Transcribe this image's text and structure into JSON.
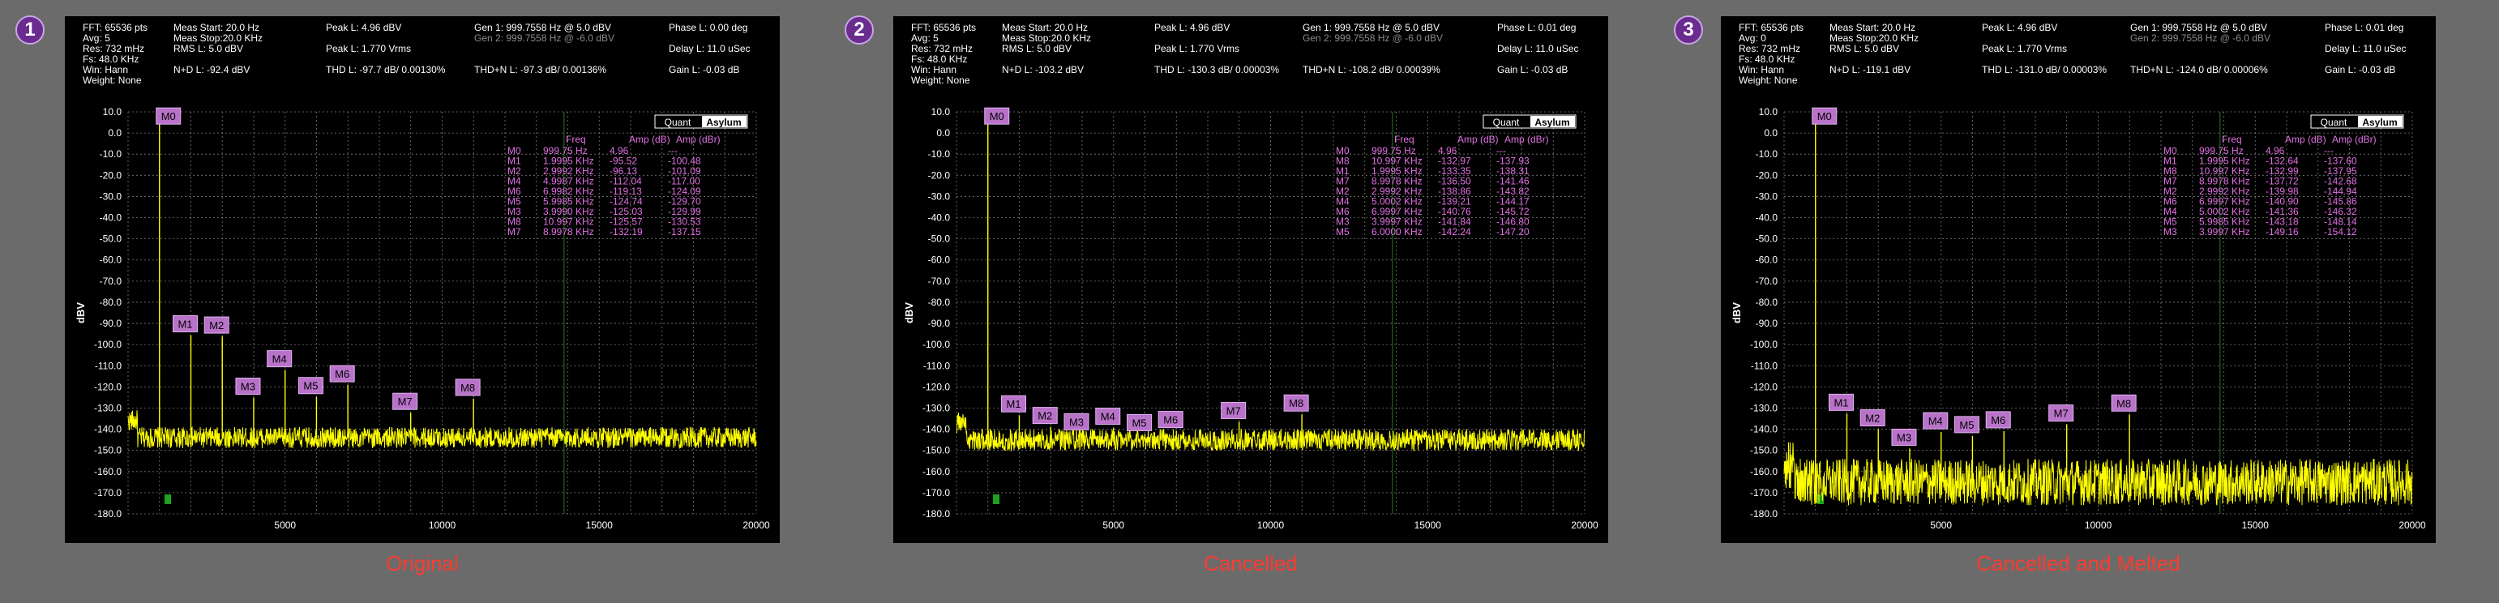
{
  "chart_data": [
    {
      "type": "line",
      "badge": "1",
      "caption": "Original",
      "header": {
        "fft": "FFT: 65536 pts",
        "avg": "Avg: 5",
        "res": "Res: 732 mHz",
        "fs": "Fs: 48.0 KHz",
        "win": "Win: Hann",
        "weight": "Weight: None",
        "meas_start": "Meas Start: 20.0 Hz",
        "meas_stop": "Meas Stop:20.0 KHz",
        "rms": "RMS L: 5.0 dBV",
        "peak_dbv": "Peak L: 4.96 dBV",
        "peak_vrms": "Peak L: 1.770 Vrms",
        "gen1": "Gen 1: 999.7558 Hz @ 5.0  dBV",
        "gen2": "Gen 2: 999.7558 Hz @ -6.0  dBV",
        "phase": "Phase L: 0.00 deg",
        "delay": "Delay L: 11.0 uSec",
        "gain": "Gain L: -0.03 dB",
        "nd": "N+D L: -92.4 dBV",
        "thd": "THD L: -97.7 dB/ 0.00130%",
        "thdn": "THD+N L: -97.3 dB/ 0.00136%"
      },
      "ylabel": "dBV",
      "ylim": [
        -180,
        10
      ],
      "y_ticks": [
        "10.0",
        "0.0",
        "-10.0",
        "-20.0",
        "-30.0",
        "-40.0",
        "-50.0",
        "-60.0",
        "-70.0",
        "-80.0",
        "-90.0",
        "-100.0",
        "-110.0",
        "-120.0",
        "-130.0",
        "-140.0",
        "-150.0",
        "-160.0",
        "-170.0",
        "-180.0"
      ],
      "xlim": [
        0,
        20000
      ],
      "x_ticks": [
        "5000",
        "10000",
        "15000",
        "20000"
      ],
      "noise_floor": -144,
      "noise_spread": 5,
      "table_headers": [
        "Freq",
        "Amp (dB)",
        "Amp (dBr)"
      ],
      "rows": [
        [
          "M0",
          "999.75 Hz",
          "4.96",
          "---"
        ],
        [
          "M1",
          "1.9995 KHz",
          "-95.52",
          "-100.48"
        ],
        [
          "M2",
          "2.9992 KHz",
          "-96.13",
          "-101.09"
        ],
        [
          "M4",
          "4.9987 KHz",
          "-112.04",
          "-117.00"
        ],
        [
          "M6",
          "6.9982 KHz",
          "-119.13",
          "-124.09"
        ],
        [
          "M5",
          "5.9985 KHz",
          "-124.74",
          "-129.70"
        ],
        [
          "M3",
          "3.9990 KHz",
          "-125.03",
          "-129.99"
        ],
        [
          "M8",
          "10.997 KHz",
          "-125.57",
          "-130.53"
        ],
        [
          "M7",
          "8.9978 KHz",
          "-132.19",
          "-137.15"
        ]
      ],
      "markers": [
        {
          "label": "M0",
          "x": 999.75,
          "y": 4.96
        },
        {
          "label": "M1",
          "x": 1999.5,
          "y": -95.52
        },
        {
          "label": "M2",
          "x": 2999.2,
          "y": -96.13
        },
        {
          "label": "M3",
          "x": 3999.0,
          "y": -125.03
        },
        {
          "label": "M4",
          "x": 4998.7,
          "y": -112.04
        },
        {
          "label": "M5",
          "x": 5998.5,
          "y": -124.74
        },
        {
          "label": "M6",
          "x": 6998.2,
          "y": -119.13
        },
        {
          "label": "M7",
          "x": 8997.8,
          "y": -132.19
        },
        {
          "label": "M8",
          "x": 10997,
          "y": -125.57
        }
      ],
      "logo": [
        "Quant",
        "Asylum"
      ]
    },
    {
      "type": "line",
      "badge": "2",
      "caption": "Cancelled",
      "header": {
        "fft": "FFT: 65536 pts",
        "avg": "Avg: 5",
        "res": "Res: 732 mHz",
        "fs": "Fs: 48.0 KHz",
        "win": "Win: Hann",
        "weight": "Weight: None",
        "meas_start": "Meas Start: 20.0 Hz",
        "meas_stop": "Meas Stop:20.0 KHz",
        "rms": "RMS L: 5.0 dBV",
        "peak_dbv": "Peak L: 4.96 dBV",
        "peak_vrms": "Peak L: 1.770 Vrms",
        "gen1": "Gen 1: 999.7558 Hz @ 5.0  dBV",
        "gen2": "Gen 2: 999.7558 Hz @ -6.0  dBV",
        "phase": "Phase L: 0.01 deg",
        "delay": "Delay L: 11.0 uSec",
        "gain": "Gain L: -0.03 dB",
        "nd": "N+D L: -103.2 dBV",
        "thd": "THD L: -130.3 dB/ 0.00003%",
        "thdn": "THD+N L: -108.2 dB/ 0.00039%"
      },
      "ylabel": "dBV",
      "ylim": [
        -180,
        10
      ],
      "y_ticks": [
        "10.0",
        "0.0",
        "-10.0",
        "-20.0",
        "-30.0",
        "-40.0",
        "-50.0",
        "-60.0",
        "-70.0",
        "-80.0",
        "-90.0",
        "-100.0",
        "-110.0",
        "-120.0",
        "-130.0",
        "-140.0",
        "-150.0",
        "-160.0",
        "-170.0",
        "-180.0"
      ],
      "xlim": [
        0,
        20000
      ],
      "x_ticks": [
        "5000",
        "10000",
        "15000",
        "20000"
      ],
      "noise_floor": -145,
      "noise_spread": 5,
      "table_headers": [
        "Freq",
        "Amp (dB)",
        "Amp (dBr)"
      ],
      "rows": [
        [
          "M0",
          "999.75 Hz",
          "4.96",
          "---"
        ],
        [
          "M8",
          "10.997 KHz",
          "-132.97",
          "-137.93"
        ],
        [
          "M1",
          "1.9995 KHz",
          "-133.35",
          "-138.31"
        ],
        [
          "M7",
          "8.9978 KHz",
          "-136.50",
          "-141.46"
        ],
        [
          "M2",
          "2.9992 KHz",
          "-138.86",
          "-143.82"
        ],
        [
          "M4",
          "5.0002 KHz",
          "-139.21",
          "-144.17"
        ],
        [
          "M6",
          "6.9997 KHz",
          "-140.76",
          "-145.72"
        ],
        [
          "M3",
          "3.9997 KHz",
          "-141.84",
          "-146.80"
        ],
        [
          "M5",
          "6.0000 KHz",
          "-142.24",
          "-147.20"
        ]
      ],
      "markers": [
        {
          "label": "M0",
          "x": 999.75,
          "y": 4.96
        },
        {
          "label": "M1",
          "x": 1999.5,
          "y": -133.35
        },
        {
          "label": "M2",
          "x": 2999.2,
          "y": -138.86
        },
        {
          "label": "M3",
          "x": 3999.7,
          "y": -141.84
        },
        {
          "label": "M4",
          "x": 5000.2,
          "y": -139.21
        },
        {
          "label": "M5",
          "x": 6000.0,
          "y": -142.24
        },
        {
          "label": "M6",
          "x": 6999.7,
          "y": -140.76
        },
        {
          "label": "M7",
          "x": 8997.8,
          "y": -136.5
        },
        {
          "label": "M8",
          "x": 10997,
          "y": -132.97
        }
      ],
      "logo": [
        "Quant",
        "Asylum"
      ]
    },
    {
      "type": "line",
      "badge": "3",
      "caption": "Cancelled and Melted",
      "header": {
        "fft": "FFT: 65536 pts",
        "avg": "Avg: 0",
        "res": "Res: 732 mHz",
        "fs": "Fs: 48.0 KHz",
        "win": "Win: Hann",
        "weight": "Weight: None",
        "meas_start": "Meas Start: 20.0 Hz",
        "meas_stop": "Meas Stop:20.0 KHz",
        "rms": "RMS L: 5.0 dBV",
        "peak_dbv": "Peak L: 4.96 dBV",
        "peak_vrms": "Peak L: 1.770 Vrms",
        "gen1": "Gen 1: 999.7558 Hz @ 5.0  dBV",
        "gen2": "Gen 2: 999.7558 Hz @ -6.0  dBV",
        "phase": "Phase L: 0.01 deg",
        "delay": "Delay L: 11.0 uSec",
        "gain": "Gain L: -0.03 dB",
        "nd": "N+D L: -119.1 dBV",
        "thd": "THD L: -131.0 dB/ 0.00003%",
        "thdn": "THD+N L: -124.0 dB/ 0.00006%"
      },
      "ylabel": "dBV",
      "ylim": [
        -180,
        10
      ],
      "y_ticks": [
        "10.0",
        "0.0",
        "-10.0",
        "-20.0",
        "-30.0",
        "-40.0",
        "-50.0",
        "-60.0",
        "-70.0",
        "-80.0",
        "-90.0",
        "-100.0",
        "-110.0",
        "-120.0",
        "-130.0",
        "-140.0",
        "-150.0",
        "-160.0",
        "-170.0",
        "-180.0"
      ],
      "xlim": [
        0,
        20000
      ],
      "x_ticks": [
        "5000",
        "10000",
        "15000",
        "20000"
      ],
      "noise_floor": -165,
      "noise_spread": 11,
      "table_headers": [
        "Freq",
        "Amp (dB)",
        "Amp (dBr)"
      ],
      "rows": [
        [
          "M0",
          "999.75 Hz",
          "4.96",
          "---"
        ],
        [
          "M1",
          "1.9995 KHz",
          "-132.64",
          "-137.60"
        ],
        [
          "M8",
          "10.997 KHz",
          "-132.99",
          "-137.95"
        ],
        [
          "M7",
          "8.9978 KHz",
          "-137.72",
          "-142.68"
        ],
        [
          "M2",
          "2.9992 KHz",
          "-139.98",
          "-144.94"
        ],
        [
          "M6",
          "6.9997 KHz",
          "-140.90",
          "-145.86"
        ],
        [
          "M4",
          "5.0002 KHz",
          "-141.36",
          "-146.32"
        ],
        [
          "M5",
          "5.9985 KHz",
          "-143.18",
          "-148.14"
        ],
        [
          "M3",
          "3.9997 KHz",
          "-149.16",
          "-154.12"
        ]
      ],
      "markers": [
        {
          "label": "M0",
          "x": 999.75,
          "y": 4.96
        },
        {
          "label": "M1",
          "x": 1999.5,
          "y": -132.64
        },
        {
          "label": "M2",
          "x": 2999.2,
          "y": -139.98
        },
        {
          "label": "M3",
          "x": 3999.7,
          "y": -149.16
        },
        {
          "label": "M4",
          "x": 5000.2,
          "y": -141.36
        },
        {
          "label": "M5",
          "x": 5998.5,
          "y": -143.18
        },
        {
          "label": "M6",
          "x": 6999.7,
          "y": -140.9
        },
        {
          "label": "M7",
          "x": 8997.8,
          "y": -137.72
        },
        {
          "label": "M8",
          "x": 10997,
          "y": -132.99
        }
      ],
      "logo": [
        "Quant",
        "Asylum"
      ]
    }
  ],
  "colors": {
    "trace": "#ffff00",
    "marker_bg": "#b873c9",
    "marker_text": "#000000",
    "table_text": "#e070e0",
    "grid": "#7a7a7a",
    "text": "#ffffff",
    "caption": "#ff3b30"
  }
}
